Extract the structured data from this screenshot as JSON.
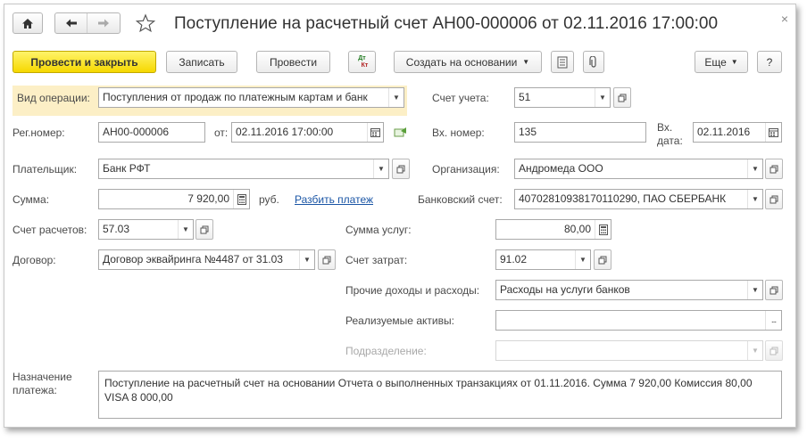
{
  "window": {
    "title": "Поступление на расчетный счет АН00-000006 от 02.11.2016 17:00:00",
    "close_glyph": "×"
  },
  "nav": {
    "home_icon": "home-icon",
    "back_icon": "arrow-left-icon",
    "forward_icon": "arrow-right-icon",
    "favorite_icon": "star-icon"
  },
  "toolbar": {
    "post_and_close": "Провести и закрыть",
    "save": "Записать",
    "post": "Провести",
    "dt_kt_label_top": "Дт",
    "dt_kt_label_bottom": "Кт",
    "create_based_on": "Создать на основании",
    "more": "Еще",
    "help": "?"
  },
  "form": {
    "operation_type": {
      "label": "Вид операции:",
      "value": "Поступления от продаж по платежным картам и банк"
    },
    "account": {
      "label": "Счет учета:",
      "value": "51"
    },
    "reg_number": {
      "label": "Рег.номер:",
      "value": "АН00-000006"
    },
    "date_from": {
      "label": "от:",
      "value": "02.11.2016 17:00:00"
    },
    "incoming_number": {
      "label": "Вх. номер:",
      "value": "135"
    },
    "incoming_date": {
      "label_line1": "Вх.",
      "label_line2": "дата:",
      "value": "02.11.2016"
    },
    "payer": {
      "label": "Плательщик:",
      "value": "Банк РФТ"
    },
    "organization": {
      "label": "Организация:",
      "value": "Андромеда ООО"
    },
    "amount": {
      "label": "Сумма:",
      "value": "7 920,00",
      "currency": "руб.",
      "split_link": "Разбить платеж"
    },
    "bank_account": {
      "label": "Банковский счет:",
      "value": "40702810938170110290, ПАО СБЕРБАНК"
    },
    "settlement_account": {
      "label": "Счет расчетов:",
      "value": "57.03"
    },
    "services_amount": {
      "label": "Сумма услуг:",
      "value": "80,00"
    },
    "contract": {
      "label": "Договор:",
      "value": "Договор эквайринга №4487 от 31.03"
    },
    "expense_account": {
      "label": "Счет затрат:",
      "value": "91.02"
    },
    "other_income_expenses": {
      "label": "Прочие доходы и расходы:",
      "value": "Расходы на услуги банков"
    },
    "sold_assets": {
      "label": "Реализуемые активы:",
      "value": ""
    },
    "department": {
      "label": "Подразделение:",
      "value": ""
    },
    "purpose": {
      "label_line1": "Назначение",
      "label_line2": "платежа:",
      "value": "Поступление на расчетный счет на основании Отчета о выполненных транзакциях от 01.11.2016. Сумма 7 920,00 Комиссия 80,00 VISA 8 000,00"
    }
  }
}
